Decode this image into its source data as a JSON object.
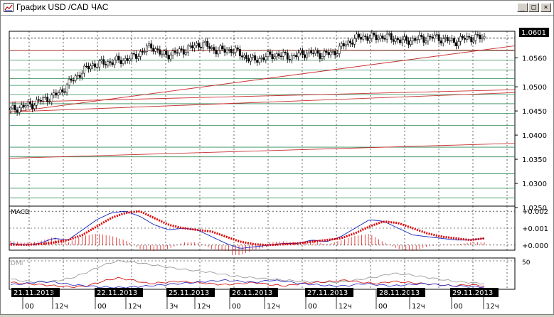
{
  "window": {
    "title": "График USD /CAD ЧАС",
    "buttons": {
      "minimize": "_",
      "maximize": "□",
      "close": "×"
    }
  },
  "colors": {
    "grid_green": "#2e8b57",
    "trend_red": "#c83030",
    "candle": "#000000",
    "macd_signal": "#e00000",
    "macd_line": "#1020c0",
    "dmi_gray": "#909090",
    "dmi_red": "#d00000",
    "dmi_blue": "#2020c0",
    "date_label_bg": "#000000",
    "date_label_text": "#ffffff",
    "current_price_bg": "#000000"
  },
  "price_panel": {
    "current_price": "1.0601",
    "axis_labels": [
      "1.0560",
      "1.0500",
      "1.0450",
      "1.0400",
      "1.0350",
      "1.0300",
      "1.0250"
    ]
  },
  "macd_panel": {
    "label": "MACD",
    "axis_labels": [
      "+0.002",
      "+0.001",
      "+0.000"
    ]
  },
  "dmi_panel": {
    "label": "DMI",
    "axis_label": "50"
  },
  "time_axis": {
    "dates": [
      "21.11.2013",
      "22.11.2013",
      "25.11.2013",
      "26.11.2013",
      "27.11.2013",
      "28.11.2013",
      "29.11.2013"
    ],
    "hours": [
      "00",
      "12ч",
      "00",
      "12ч",
      "3ч",
      "12ч",
      "00",
      "12ч",
      "00",
      "12ч",
      "00",
      "12ч",
      "00",
      "12ч"
    ]
  },
  "chart_data": {
    "type": "candlestick",
    "symbol": "USD/CAD",
    "timeframe": "1H",
    "ylim": [
      1.0225,
      1.0615
    ],
    "days": [
      "21.11.2013",
      "22.11.2013",
      "25.11.2013",
      "26.11.2013",
      "27.11.2013",
      "28.11.2013",
      "29.11.2013"
    ],
    "close_path": [
      1.0452,
      1.0458,
      1.0463,
      1.0472,
      1.0478,
      1.049,
      1.0512,
      1.053,
      1.0545,
      1.0548,
      1.0552,
      1.0555,
      1.056,
      1.0572,
      1.0585,
      1.0566,
      1.0568,
      1.0575,
      1.0582,
      1.059,
      1.0578,
      1.0575,
      1.0577,
      1.0565,
      1.0555,
      1.056,
      1.0566,
      1.0565,
      1.0562,
      1.057,
      1.057,
      1.0567,
      1.057,
      1.0585,
      1.0598,
      1.0604,
      1.0602,
      1.0604,
      1.06,
      1.0594,
      1.0598,
      1.06,
      1.0603,
      1.0598,
      1.0593,
      1.06,
      1.0602,
      1.0601
    ],
    "macd_signal": [
      3e-05,
      2e-05,
      5e-05,
      0.00015,
      0.0003,
      0.0006,
      0.0011,
      0.0016,
      0.0019,
      0.002,
      0.0016,
      0.0012,
      0.001,
      0.0009,
      0.0008,
      0.0005,
      0.0002,
      5e-05,
      0.0,
      5e-05,
      0.0001,
      0.0002,
      0.0003,
      0.0004,
      0.0007,
      0.0011,
      0.0014,
      0.0013,
      0.001,
      0.0007,
      0.0005,
      0.0004,
      0.0003,
      0.0004
    ],
    "macd_line": [
      0.0001,
      0.0,
      0.0001,
      0.0004,
      0.0003,
      0.0009,
      0.0015,
      0.0019,
      0.002,
      0.0017,
      0.0012,
      0.0009,
      0.001,
      0.0009,
      0.0005,
      0.0001,
      -0.0002,
      -0.0001,
      0.0,
      0.0001,
      0.0001,
      0.0003,
      0.0002,
      0.0005,
      0.001,
      0.0015,
      0.0014,
      0.001,
      0.0006,
      0.0005,
      0.0004,
      0.0003,
      0.0003,
      0.0004
    ],
    "dmi_gray": [
      18,
      14,
      12,
      15,
      20,
      30,
      42,
      50,
      48,
      44,
      40,
      36,
      33,
      30,
      26,
      22,
      20,
      18,
      16,
      14,
      13,
      12,
      14,
      18,
      22,
      28,
      26,
      22,
      18,
      14,
      12,
      10
    ],
    "dmi_red": [
      12,
      10,
      8,
      6,
      4,
      6,
      14,
      20,
      16,
      10,
      12,
      14,
      12,
      10,
      8,
      10,
      12,
      8,
      6,
      10,
      12,
      14,
      16,
      12,
      10,
      14,
      12,
      10,
      8,
      6,
      8,
      6
    ],
    "dmi_blue": [
      8,
      10,
      14,
      12,
      8,
      6,
      4,
      3,
      4,
      6,
      8,
      10,
      12,
      14,
      16,
      14,
      12,
      16,
      14,
      10,
      8,
      6,
      6,
      10,
      8,
      6,
      8,
      10,
      8,
      6,
      5,
      4
    ],
    "macd_range": [
      -0.0003,
      0.0023
    ],
    "dmi_range": [
      0,
      55
    ]
  }
}
